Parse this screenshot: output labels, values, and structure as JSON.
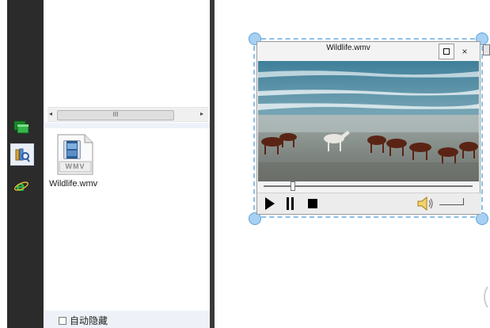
{
  "taskbar": {
    "icons": [
      {
        "name": "green-window-icon"
      },
      {
        "name": "library-icon"
      },
      {
        "name": "ie-browser-icon"
      }
    ]
  },
  "explorer": {
    "scroll_thumb_label": "III",
    "file": {
      "name": "Wildlife.wmv",
      "icon": "wmv-file-icon",
      "badge": "WMV"
    },
    "autohide_label": "自动隐藏"
  },
  "player": {
    "title": "Wildlife.wmv",
    "close_glyph": "×",
    "seek_position": 0.13,
    "colors": {
      "selection": "#8cc0e8",
      "handle": "#a7d0f2"
    }
  }
}
